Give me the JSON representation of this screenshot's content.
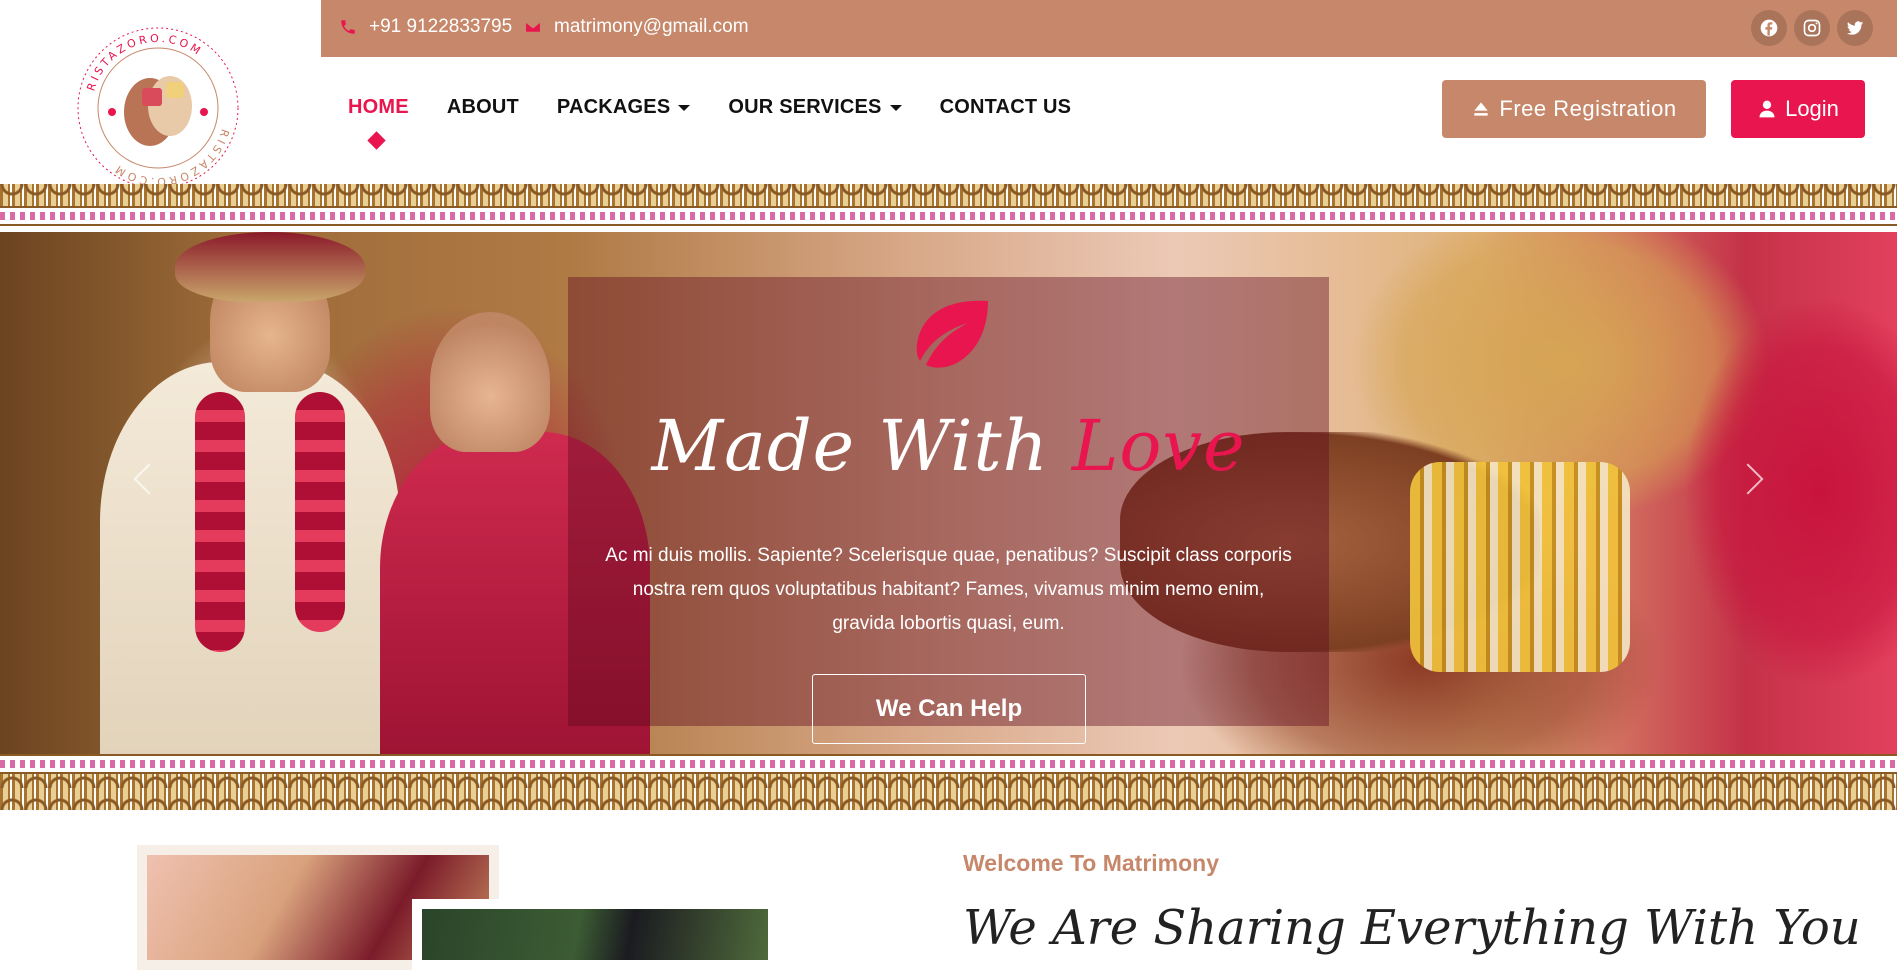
{
  "logo": {
    "text": "RISTAZORO.COM"
  },
  "topbar": {
    "phone": "+91 9122833795",
    "email": "matrimony@gmail.com",
    "social": [
      "facebook-icon",
      "instagram-icon",
      "twitter-icon"
    ],
    "color": "#c6876a"
  },
  "nav": {
    "items": [
      {
        "label": "HOME",
        "active": true
      },
      {
        "label": "ABOUT"
      },
      {
        "label": "PACKAGES",
        "dropdown": true
      },
      {
        "label": "OUR SERVICES",
        "dropdown": true
      },
      {
        "label": "CONTACT US"
      }
    ]
  },
  "buttons": {
    "free_registration": "Free Registration",
    "login": "Login"
  },
  "hero": {
    "title_main": "Made With ",
    "title_accent": "Love",
    "description": "Ac mi duis mollis. Sapiente? Scelerisque quae, penatibus? Suscipit class corporis nostra rem quos voluptatibus habitant? Fames, vivamus minim nemo enim, gravida lobortis quasi, eum.",
    "cta": "We Can Help"
  },
  "about": {
    "welcome": "Welcome To Matrimony",
    "heading": "We Are Sharing Everything With You"
  },
  "colors": {
    "accent": "#e8154e",
    "brand": "#c6876a"
  }
}
